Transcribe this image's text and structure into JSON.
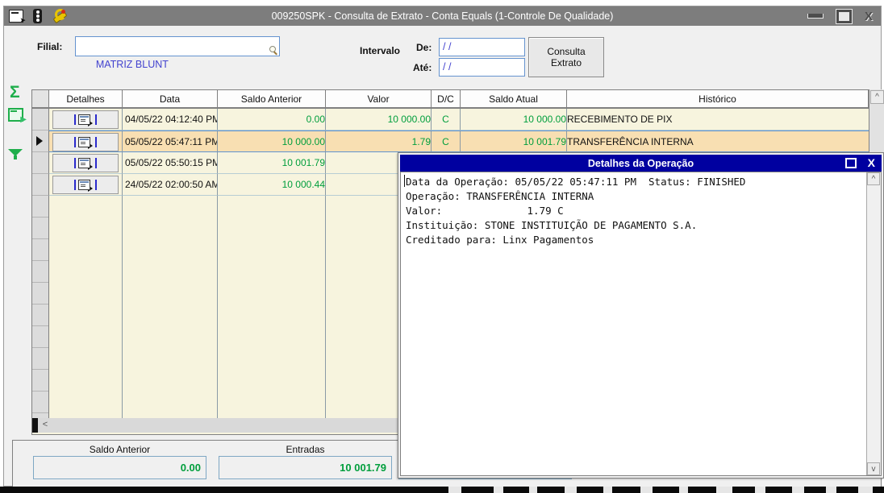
{
  "window": {
    "title": "009250SPK - Consulta de Extrato - Conta Equals (1-Controle De Qualidade)",
    "close_glyph": "X"
  },
  "form": {
    "filial_label": "Filial:",
    "filial_value": "MATRIZ BLUNT",
    "intervalo_label": "Intervalo",
    "de_label": "De:",
    "de_value": "/ /",
    "ate_label": "Até:",
    "ate_value": "/ /",
    "consulta_button": "Consulta Extrato"
  },
  "grid": {
    "headers": [
      "Detalhes",
      "Data",
      "Saldo Anterior",
      "Valor",
      "D/C",
      "Saldo Atual",
      "Histórico"
    ],
    "rows": [
      {
        "data": "04/05/22 04:12:40 PM",
        "saldo_anterior": "0.00",
        "valor": "10 000.00",
        "dc": "C",
        "saldo_atual": "10 000.00",
        "historico": "RECEBIMENTO DE PIX",
        "selected": false
      },
      {
        "data": "05/05/22 05:47:11 PM",
        "saldo_anterior": "10 000.00",
        "valor": "1.79",
        "dc": "C",
        "saldo_atual": "10 001.79",
        "historico": "TRANSFERÊNCIA INTERNA",
        "selected": true
      },
      {
        "data": "05/05/22 05:50:15 PM",
        "saldo_anterior": "10 001.79",
        "valor": "",
        "dc": "",
        "saldo_atual": "",
        "historico": "",
        "selected": false
      },
      {
        "data": "24/05/22 02:00:50 AM",
        "saldo_anterior": "10 000.44",
        "valor": "",
        "dc": "",
        "saldo_atual": "",
        "historico": "",
        "selected": false
      }
    ],
    "scroll_up_glyph": "^",
    "scroll_left_glyph": "<"
  },
  "popup": {
    "title": "Detalhes da Operação",
    "lines": [
      "Data da Operação: 05/05/22 05:47:11 PM  Status: FINISHED",
      "Operação: TRANSFERÊNCIA INTERNA",
      "Valor:              1.79 C",
      "Instituição: STONE INSTITUIÇÃO DE PAGAMENTO S.A.",
      "Creditado para: Linx Pagamentos"
    ],
    "close_glyph": "X",
    "scroll_up_glyph": "^",
    "scroll_down_glyph": "v"
  },
  "summary": {
    "saldo_anterior_label": "Saldo Anterior",
    "saldo_anterior_value": "0.00",
    "entradas_label": "Entradas",
    "entradas_value": "10 001.79"
  },
  "icons": {
    "titlebar": [
      "export-form-icon",
      "traffic-light-icon",
      "wrench-icon"
    ],
    "sidebar": [
      "sigma-icon",
      "export-row-icon",
      "filter-funnel-icon"
    ],
    "filial_input": "search-icon",
    "details_cell": "details-window-icon"
  },
  "colors": {
    "titlebar_gray": "#7d7d7d",
    "popup_titlebar_navy": "#0000a0",
    "grid_row_cream": "#f7f4de",
    "selected_row_orange": "#f8dfb2",
    "value_green": "#009e3c",
    "input_text_blue": "#4343cf",
    "sidebar_icon_green": "#1fae4b",
    "input_border_blue": "#6593cf"
  }
}
